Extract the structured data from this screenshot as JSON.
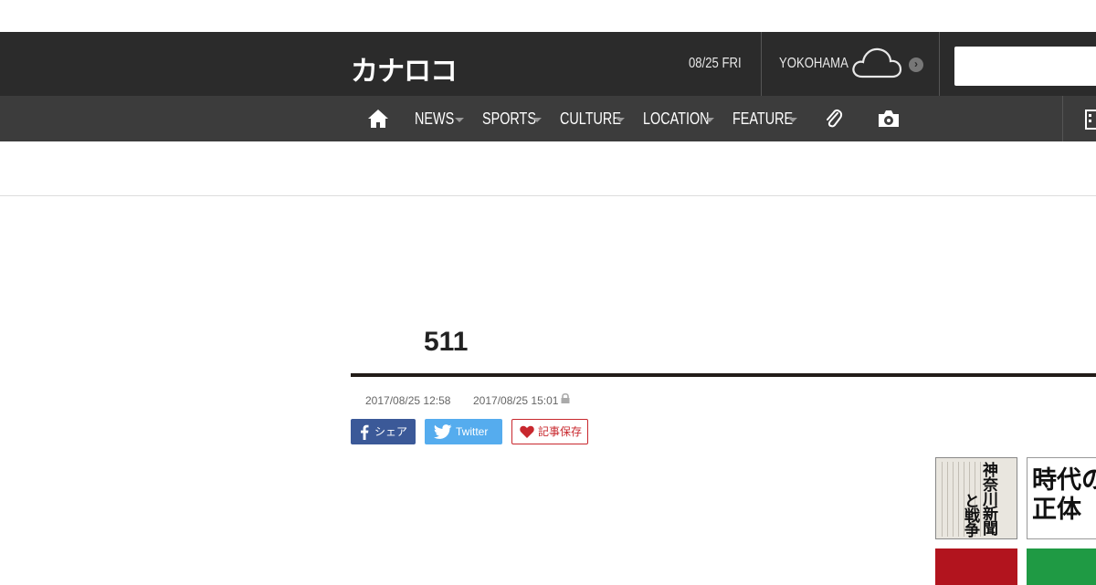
{
  "header": {
    "logo_text": "カナロコ",
    "date": "08/25 FRI",
    "weather": {
      "city": "YOKOHAMA",
      "icon": "cloud-icon",
      "more_icon": "chevron-right-icon"
    },
    "search": {
      "value": "",
      "placeholder": ""
    }
  },
  "nav": {
    "home_icon": "home-icon",
    "items": [
      {
        "label": "NEWS"
      },
      {
        "label": "SPORTS"
      },
      {
        "label": "CULTURE"
      },
      {
        "label": "LOCATION"
      },
      {
        "label": "FEATURE"
      }
    ],
    "clip_icon": "paperclip-icon",
    "camera_icon": "camera-icon",
    "building_icon": "building-icon"
  },
  "article": {
    "title": "511",
    "published": "2017/08/25 12:58",
    "updated": "2017/08/25 15:01",
    "updated_icon": "lock-icon"
  },
  "share": {
    "facebook_label": "シェア",
    "twitter_label": "Twitter",
    "save_label": "記事保存"
  },
  "banners": {
    "newspaper_title": "神奈川新聞",
    "newspaper_subtitle": "と戦争",
    "era_line1": "時代の",
    "era_line2": "正体"
  },
  "colors": {
    "header_bg": "#2b2b2b",
    "nav_bg": "#3c3c3c",
    "facebook": "#3b5998",
    "twitter": "#55acee",
    "save": "#c8282e",
    "banner_red": "#b2141e",
    "banner_green": "#1f9a44"
  }
}
